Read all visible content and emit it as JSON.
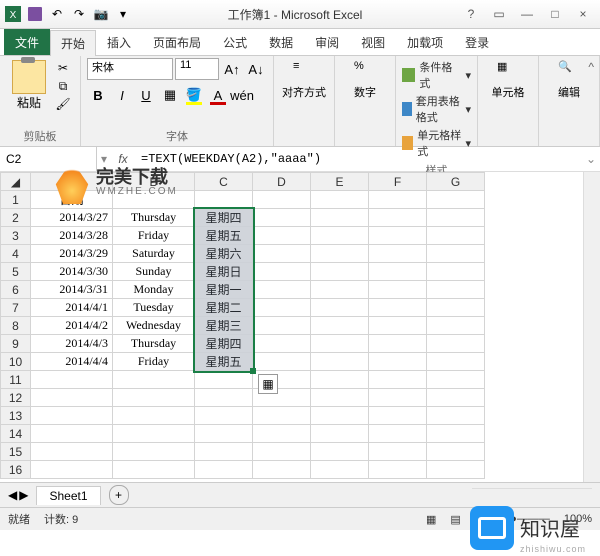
{
  "title": "工作簿1 - Microsoft Excel",
  "qat_icons": [
    "excel",
    "save",
    "undo",
    "redo",
    "camera"
  ],
  "tabs": {
    "file": "文件",
    "items": [
      "开始",
      "插入",
      "页面布局",
      "公式",
      "数据",
      "审阅",
      "视图",
      "加载项",
      "登录"
    ],
    "active": "开始"
  },
  "ribbon": {
    "clipboard": {
      "paste": "粘贴",
      "label": "剪贴板"
    },
    "font": {
      "name": "宋体",
      "size": "11",
      "label": "字体"
    },
    "align": {
      "label": "对齐方式"
    },
    "number": {
      "label": "数字"
    },
    "styles": {
      "cond": "条件格式",
      "tbl": "套用表格格式",
      "cell": "单元格样式",
      "label": "样式"
    },
    "cells": {
      "label": "单元格"
    },
    "edit": {
      "label": "编辑"
    }
  },
  "namebox": "C2",
  "formula": "=TEXT(WEEKDAY(A2),\"aaaa\")",
  "columns": [
    "A",
    "B",
    "C",
    "D",
    "E",
    "F",
    "G"
  ],
  "header_row": {
    "A": "日期"
  },
  "rows": [
    {
      "n": 2,
      "A": "2014/3/27",
      "B": "Thursday",
      "C": "星期四"
    },
    {
      "n": 3,
      "A": "2014/3/28",
      "B": "Friday",
      "C": "星期五"
    },
    {
      "n": 4,
      "A": "2014/3/29",
      "B": "Saturday",
      "C": "星期六"
    },
    {
      "n": 5,
      "A": "2014/3/30",
      "B": "Sunday",
      "C": "星期日"
    },
    {
      "n": 6,
      "A": "2014/3/31",
      "B": "Monday",
      "C": "星期一"
    },
    {
      "n": 7,
      "A": "2014/4/1",
      "B": "Tuesday",
      "C": "星期二"
    },
    {
      "n": 8,
      "A": "2014/4/2",
      "B": "Wednesday",
      "C": "星期三"
    },
    {
      "n": 9,
      "A": "2014/4/3",
      "B": "Thursday",
      "C": "星期四"
    },
    {
      "n": 10,
      "A": "2014/4/4",
      "B": "Friday",
      "C": "星期五"
    }
  ],
  "sheet": "Sheet1",
  "status": {
    "ready": "就绪",
    "avg": "计数: 9",
    "views": "",
    "zoom": "100%"
  },
  "watermark": {
    "main": "完美下载",
    "sub": "WMZHE.COM"
  },
  "zhishiwu": {
    "text": "知识屋",
    "url": "zhishiwu.com"
  }
}
